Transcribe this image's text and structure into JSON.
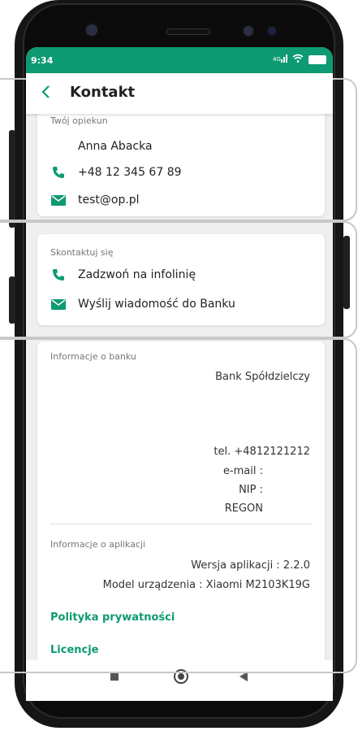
{
  "status_bar": {
    "time": "9:34",
    "signal": "4G",
    "battery": "100"
  },
  "header": {
    "back_icon": "chevron-left-icon",
    "title": "Kontakt"
  },
  "advisor": {
    "section_label": "Twój opiekun",
    "name": "Anna Abacka",
    "phone": "+48 12 345 67 89",
    "email": "test@op.pl"
  },
  "contact": {
    "section_label": "Skontaktuj się",
    "call_label": "Zadzwoń na infolinię",
    "message_label": "Wyślij wiadomość do Banku"
  },
  "bank_info": {
    "section_label": "Informacje o banku",
    "bank_name": "Bank Spółdzielczy",
    "tel": "tel. +4812121212",
    "email": "e-mail :",
    "nip": "NIP :",
    "regon": "REGON"
  },
  "app_info": {
    "section_label": "Informacje o aplikacji",
    "version": "Wersja aplikacji : 2.2.0",
    "device": "Model urządzenia : Xiaomi M2103K19G",
    "privacy_link": "Polityka prywatności",
    "licenses_link": "Licencje"
  },
  "colors": {
    "accent": "#0e9a72",
    "background": "#efeff0",
    "card": "#ffffff"
  }
}
